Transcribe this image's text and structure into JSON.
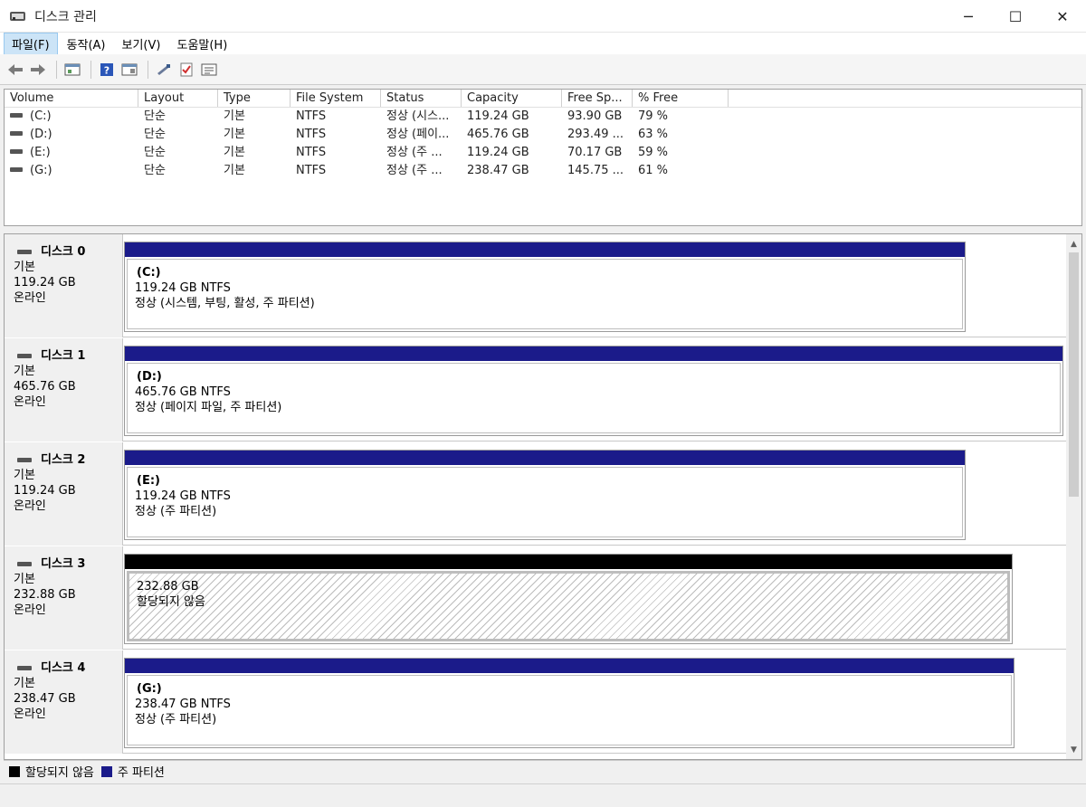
{
  "window": {
    "title": "디스크 관리",
    "minimize": "─",
    "maximize": "☐",
    "close": "✕"
  },
  "menu": [
    "파일(F)",
    "동작(A)",
    "보기(V)",
    "도움말(H)"
  ],
  "toolbar_icons": [
    "back-icon",
    "forward-icon",
    "disk-list-icon",
    "help-icon",
    "properties-icon",
    "rescan-icon",
    "check-icon",
    "settings-icon"
  ],
  "volume_table": {
    "headers": [
      "Volume",
      "Layout",
      "Type",
      "File System",
      "Status",
      "Capacity",
      "Free Sp...",
      "% Free"
    ],
    "rows": [
      {
        "volume": "(C:)",
        "layout": "단순",
        "type": "기본",
        "fs": "NTFS",
        "status": "정상 (시스...",
        "capacity": "119.24 GB",
        "free": "93.90 GB",
        "pct": "79 %"
      },
      {
        "volume": "(D:)",
        "layout": "단순",
        "type": "기본",
        "fs": "NTFS",
        "status": "정상 (페이...",
        "capacity": "465.76 GB",
        "free": "293.49 ...",
        "pct": "63 %"
      },
      {
        "volume": "(E:)",
        "layout": "단순",
        "type": "기본",
        "fs": "NTFS",
        "status": "정상 (주 ...",
        "capacity": "119.24 GB",
        "free": "70.17 GB",
        "pct": "59 %"
      },
      {
        "volume": "(G:)",
        "layout": "단순",
        "type": "기본",
        "fs": "NTFS",
        "status": "정상 (주 ...",
        "capacity": "238.47 GB",
        "free": "145.75 ...",
        "pct": "61 %"
      }
    ]
  },
  "disks": [
    {
      "name": "디스크 0",
      "type": "기본",
      "size": "119.24 GB",
      "state": "온라인",
      "partition": {
        "label": "(C:)",
        "info": "119.24 GB NTFS",
        "status": "정상 (시스템, 부팅, 활성, 주 파티션)",
        "kind": "primary"
      }
    },
    {
      "name": "디스크 1",
      "type": "기본",
      "size": "465.76 GB",
      "state": "온라인",
      "partition": {
        "label": "(D:)",
        "info": "465.76 GB NTFS",
        "status": "정상 (페이지 파일, 주 파티션)",
        "kind": "primary"
      }
    },
    {
      "name": "디스크 2",
      "type": "기본",
      "size": "119.24 GB",
      "state": "온라인",
      "partition": {
        "label": "(E:)",
        "info": "119.24 GB NTFS",
        "status": "정상 (주 파티션)",
        "kind": "primary"
      }
    },
    {
      "name": "디스크 3",
      "type": "기본",
      "size": "232.88 GB",
      "state": "온라인",
      "partition": {
        "label": "",
        "info": "232.88 GB",
        "status": "할당되지 않음",
        "kind": "unallocated"
      }
    },
    {
      "name": "디스크 4",
      "type": "기본",
      "size": "238.47 GB",
      "state": "온라인",
      "partition": {
        "label": "(G:)",
        "info": "238.47 GB NTFS",
        "status": "정상 (주 파티션)",
        "kind": "primary"
      }
    }
  ],
  "legend": [
    {
      "label": "할당되지 않음",
      "color": "#000000"
    },
    {
      "label": "주 파티션",
      "color": "#1b1b8a"
    }
  ]
}
